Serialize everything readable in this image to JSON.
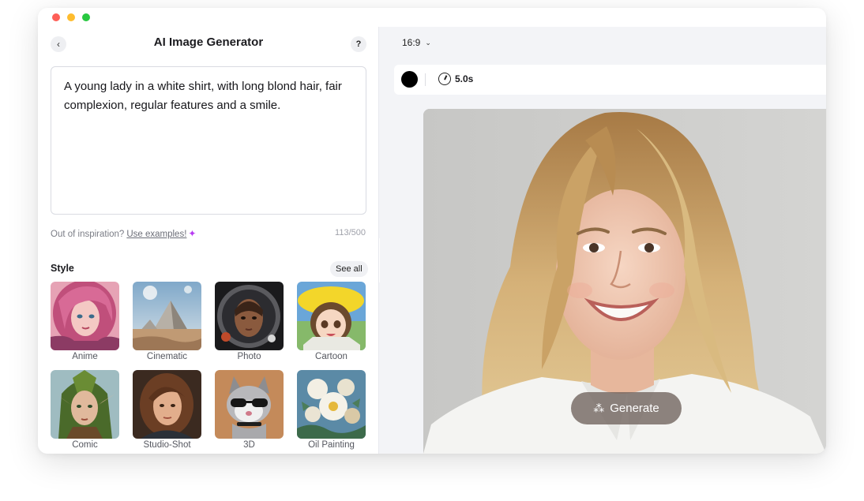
{
  "window": {
    "controls": [
      "close",
      "minimize",
      "zoom"
    ]
  },
  "left_panel": {
    "title": "AI Image Generator",
    "back_icon": "chevron-left-icon",
    "back_glyph": "‹",
    "help_label": "?",
    "prompt": {
      "value": "A young lady in a white shirt, with long blond hair, fair complexion, regular features and a smile.",
      "char_count": "113/500"
    },
    "inspiration": {
      "text": "Out of inspiration?",
      "link": "Use examples!",
      "icon": "sparkle-icon",
      "icon_glyph": "✦",
      "icon_color": "#b83cf2"
    },
    "style": {
      "label": "Style",
      "see_all": "See all",
      "collapse_glyph": "‹",
      "items": [
        {
          "label": "Anime"
        },
        {
          "label": "Cinematic"
        },
        {
          "label": "Photo"
        },
        {
          "label": "Cartoon"
        },
        {
          "label": "Comic"
        },
        {
          "label": "Studio-Shot"
        },
        {
          "label": "3D"
        },
        {
          "label": "Oil Painting"
        }
      ]
    }
  },
  "right_panel": {
    "aspect_ratio": "16:9",
    "ratio_chevron": "⌄",
    "color_swatch": "#000000",
    "duration": "5.0s",
    "generate_label": "Generate",
    "generate_icon": "magic-wand-icon",
    "generate_glyph": "⁂"
  },
  "colors": {
    "accent_sparkle": "#b83cf2",
    "generate_button": "#6e625c"
  }
}
